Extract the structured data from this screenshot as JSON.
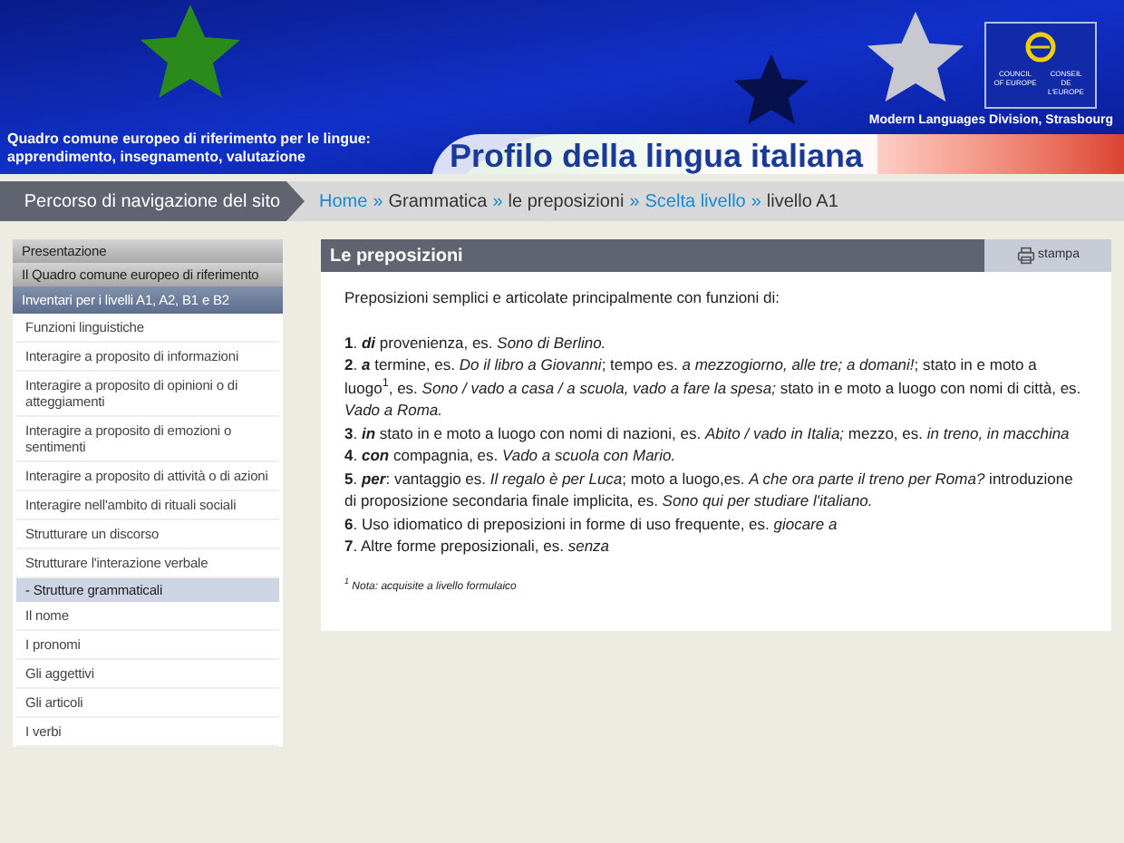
{
  "header": {
    "subtitle_lines": [
      "Quadro comune europeo di riferimento per le lingue:",
      "apprendimento, insegnamento, valutazione"
    ],
    "title": "Profilo della lingua italiana",
    "logo_texts": [
      "COUNCIL OF EUROPE",
      "CONSEIL DE L'EUROPE"
    ],
    "division": "Modern Languages Division, Strasbourg"
  },
  "nav_label": "Percorso di navigazione del sito",
  "breadcrumb": [
    {
      "label": "Home",
      "link": true
    },
    {
      "label": "Grammatica",
      "link": false
    },
    {
      "label": "le preposizioni",
      "link": false
    },
    {
      "label": "Scelta livello",
      "link": true
    },
    {
      "label": "livello A1",
      "link": false
    }
  ],
  "breadcrumb_separator": "»",
  "sidebar": {
    "items": [
      {
        "label": "Presentazione",
        "kind": "section",
        "selected": false
      },
      {
        "label": "Il Quadro comune europeo di riferimento",
        "kind": "section",
        "selected": false
      },
      {
        "label": "Inventari per i livelli A1, A2, B1 e B2",
        "kind": "section",
        "selected": true
      },
      {
        "label": "Funzioni linguistiche",
        "kind": "item",
        "selected": false
      },
      {
        "label": "Interagire a proposito di informazioni",
        "kind": "item",
        "selected": false
      },
      {
        "label": "Interagire a proposito di opinioni o di atteggiamenti",
        "kind": "item",
        "selected": false
      },
      {
        "label": "Interagire a proposito di emozioni o sentimenti",
        "kind": "item",
        "selected": false
      },
      {
        "label": "Interagire a proposito di attività o di azioni",
        "kind": "item",
        "selected": false
      },
      {
        "label": "Interagire nell'ambito di rituali sociali",
        "kind": "item",
        "selected": false
      },
      {
        "label": "Strutturare un discorso",
        "kind": "item",
        "selected": false
      },
      {
        "label": "Strutturare l'interazione verbale",
        "kind": "item",
        "selected": false
      },
      {
        "label": "- Strutture grammaticali",
        "kind": "item",
        "selected": true
      },
      {
        "label": "Il nome",
        "kind": "item",
        "selected": false
      },
      {
        "label": "I pronomi",
        "kind": "item",
        "selected": false
      },
      {
        "label": "Gli aggettivi",
        "kind": "item",
        "selected": false
      },
      {
        "label": "Gli articoli",
        "kind": "item",
        "selected": false
      },
      {
        "label": "I verbi",
        "kind": "item",
        "selected": false
      }
    ]
  },
  "content": {
    "title": "Le preposizioni",
    "print_label": "stampa",
    "number_suffix": ".",
    "intro": "Preposizioni semplici e articolate principalmente con funzioni di:",
    "list": [
      {
        "number": "1",
        "prep": "di",
        "text": "provenienza, es. *Sono di Berlino.*"
      },
      {
        "number": "2",
        "prep": "a",
        "text": "termine, es. *Do il libro a Giovanni*; tempo es. *a mezzogiorno, alle tre; a domani!*; stato in e moto a luogo$^{1}$, es. *Sono / vado a casa / a scuola, vado a fare la spesa;* stato in e moto a luogo con nomi di città, es. *Vado a Roma.*"
      },
      {
        "number": "3",
        "prep": "in",
        "text": "stato in e moto a luogo con nomi di nazioni, es. *Abito / vado in Italia;* mezzo, es. *in treno, in macchina*"
      },
      {
        "number": "4",
        "prep": "con",
        "text": "compagnia, es. *Vado a scuola con Mario.*"
      },
      {
        "number": "5",
        "prep": "per",
        "text": ": vantaggio es. *Il regalo è per Luca*; moto a luogo,es. *A che ora parte il treno per Roma?* introduzione di proposizione secondaria finale implicita, es. *Sono qui per studiare l'italiano.*"
      },
      {
        "number": "6",
        "text": "Uso idiomatico di preposizioni in forme di uso frequente, es. *giocare a*"
      },
      {
        "number": "7",
        "text": "Altre forme preposizionali, es. *senza*"
      }
    ],
    "footnote": "$^{1}$ Nota: acquisite a livello formulaico"
  }
}
